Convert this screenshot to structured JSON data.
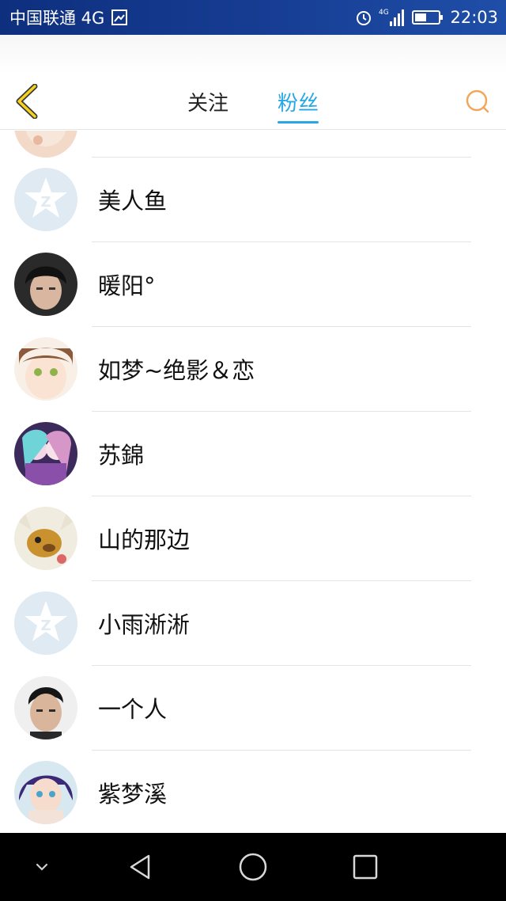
{
  "status_bar": {
    "carrier": "中国联通 4G",
    "time": "22:03",
    "icons": [
      "sim-card-icon",
      "alarm-icon",
      "signal-4g-icon",
      "battery-icon"
    ]
  },
  "header": {
    "back_icon": "chevron-left-icon",
    "tabs": [
      {
        "label": "关注",
        "active": false
      },
      {
        "label": "粉丝",
        "active": true
      }
    ],
    "search_icon": "search-icon",
    "accent": "#27a7e7"
  },
  "fans": [
    {
      "name": "",
      "avatar": "anime-avatar"
    },
    {
      "name": "美人鱼",
      "avatar": "default-qq-avatar"
    },
    {
      "name": "暖阳°",
      "avatar": "photo-avatar"
    },
    {
      "name": "如梦~绝影＆恋",
      "avatar": "anime-avatar"
    },
    {
      "name": "苏錦",
      "avatar": "anime-avatar"
    },
    {
      "name": "山的那边",
      "avatar": "cartoon-dog-avatar"
    },
    {
      "name": "小雨淅淅",
      "avatar": "default-qq-avatar"
    },
    {
      "name": "一个人",
      "avatar": "photo-avatar"
    },
    {
      "name": "紫梦溪",
      "avatar": "anime-avatar"
    }
  ],
  "system_nav": {
    "keys": [
      "collapse-icon",
      "back-triangle-icon",
      "home-circle-icon",
      "recents-square-icon"
    ]
  }
}
